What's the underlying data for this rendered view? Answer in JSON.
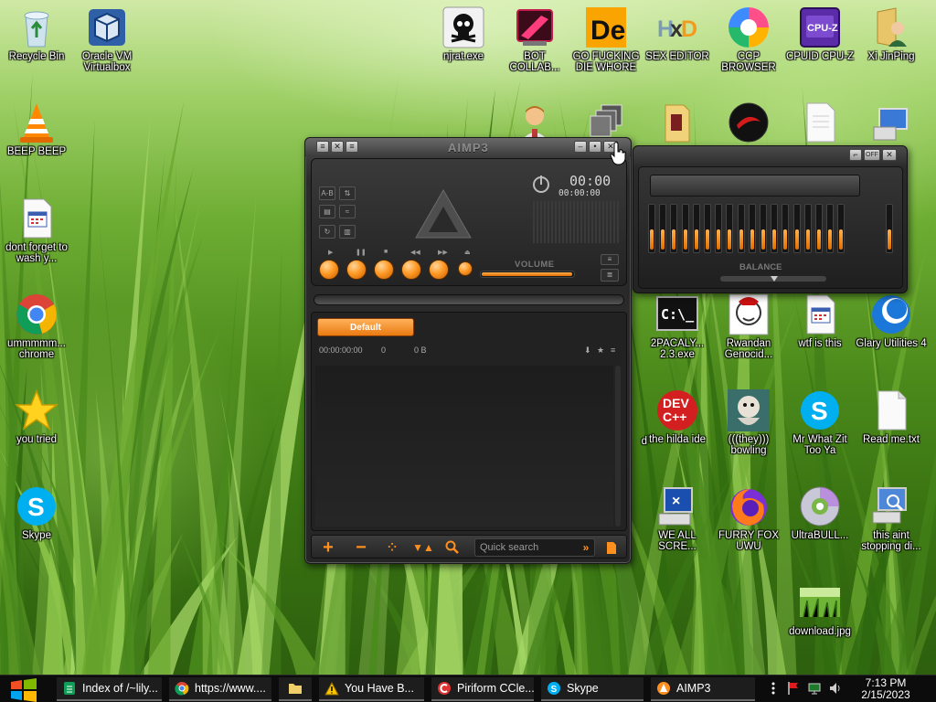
{
  "desktop": {
    "icons": [
      {
        "id": "recycle",
        "label": "Recycle Bin"
      },
      {
        "id": "vbox",
        "label": "Oracle VM Virtualbox"
      },
      {
        "id": "njrat",
        "label": "njrat.exe"
      },
      {
        "id": "bot",
        "label": "BOT COLLAB..."
      },
      {
        "id": "gofd",
        "label": "GO FUCKING DIE WHORE"
      },
      {
        "id": "hxd",
        "label": "SEX EDITOR"
      },
      {
        "id": "ccp",
        "label": "CCP BROWSER"
      },
      {
        "id": "cpuz",
        "label": "CPUID CPU-Z"
      },
      {
        "id": "xi",
        "label": "Xi JinPing"
      },
      {
        "id": "vlc",
        "label": "BEEP BEEP"
      },
      {
        "id": "dont",
        "label": "dont forget to wash y..."
      },
      {
        "id": "chrome",
        "label": "ummmmm... chrome"
      },
      {
        "id": "star",
        "label": "you tried"
      },
      {
        "id": "skype",
        "label": "Skype"
      },
      {
        "id": "pacaly",
        "label": "2PACALY... 2.3.exe"
      },
      {
        "id": "rwandan",
        "label": "Rwandan Genocid..."
      },
      {
        "id": "wtf",
        "label": "wtf is this"
      },
      {
        "id": "glary",
        "label": "Glary Utilities 4"
      },
      {
        "id": "devcpp",
        "label": "the hilda ide"
      },
      {
        "id": "bowling",
        "label": "(((they))) bowling"
      },
      {
        "id": "mrwhat",
        "label": "Mr What Zit Too Ya"
      },
      {
        "id": "readme",
        "label": "Read me.txt"
      },
      {
        "id": "partial",
        "label": "d"
      },
      {
        "id": "weall",
        "label": "WE ALL SCRE..."
      },
      {
        "id": "firefox",
        "label": "FURRY FOX UWU"
      },
      {
        "id": "ultra",
        "label": "UltraBULL..."
      },
      {
        "id": "thisaint",
        "label": "this aint stopping di..."
      },
      {
        "id": "download",
        "label": "download.jpg"
      }
    ]
  },
  "aimp": {
    "title": "AIMP3",
    "time_main": "00:00",
    "time_sub": "00:00:00",
    "volume_label": "VOLUME",
    "volume_level": 0.97,
    "playlist_tab": "Default",
    "playlist_duration": "00:00:00:00",
    "playlist_count": "0",
    "playlist_size": "0 B",
    "quick_search_placeholder": "Quick search",
    "colors": {
      "accent": "#ff8f1f",
      "body": "#262626"
    }
  },
  "equalizer": {
    "toggle_label": "OFF",
    "balance_label": "BALANCE",
    "balance_value": 0.5,
    "bands": 18
  },
  "taskbar": {
    "tasks": [
      {
        "label": "Index of /~lily...",
        "icon": "sheets-icon"
      },
      {
        "label": "https://www....",
        "icon": "chrome-icon"
      },
      {
        "label": "",
        "icon": "folder-icon"
      },
      {
        "label": "You Have B...",
        "icon": "warning-icon"
      },
      {
        "label": "Piriform CCle...",
        "icon": "ccleaner-icon"
      },
      {
        "label": "Skype",
        "icon": "skype-icon"
      },
      {
        "label": "AIMP3",
        "icon": "aimp-icon"
      }
    ],
    "clock_time": "7:13 PM",
    "clock_date": "2/15/2023"
  }
}
